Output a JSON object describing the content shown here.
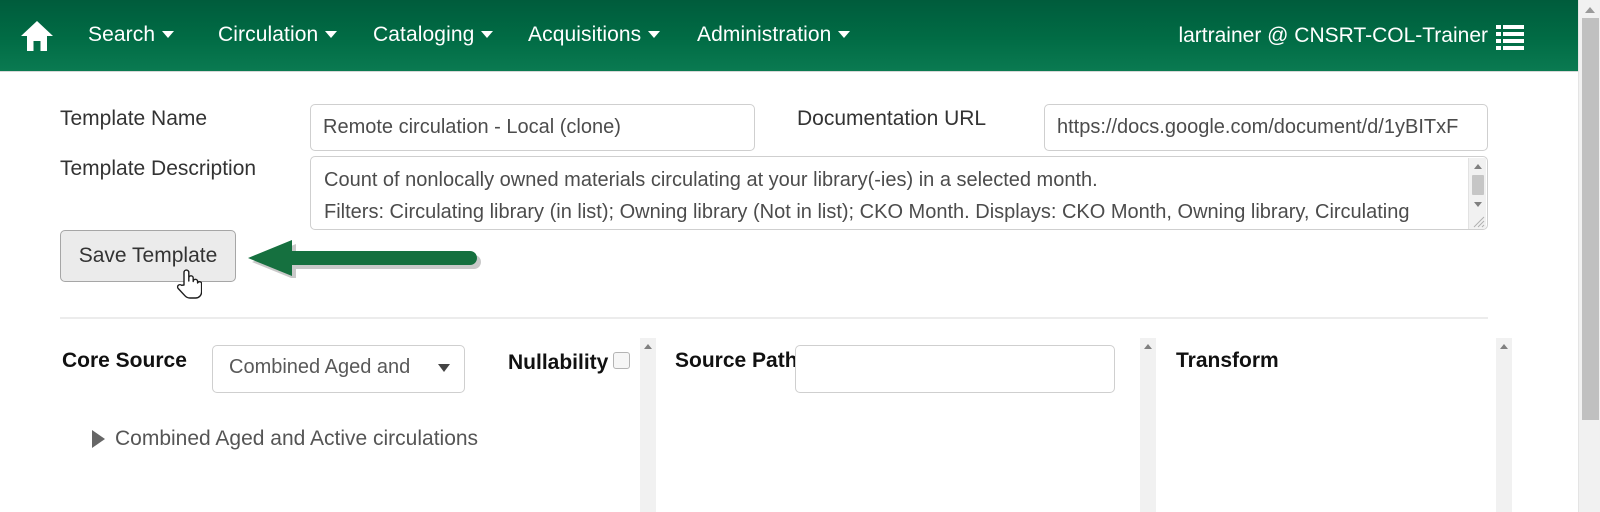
{
  "navbar": {
    "home_icon": "home-icon",
    "menu_icon": "list-icon",
    "items": [
      {
        "label": "Search",
        "caret": true
      },
      {
        "label": "Circulation",
        "caret": true
      },
      {
        "label": "Cataloging",
        "caret": true
      },
      {
        "label": "Acquisitions",
        "caret": true
      },
      {
        "label": "Administration",
        "caret": true
      }
    ],
    "user": "lartrainer @ CNSRT-COL-Trainer",
    "background_color": "#016c45"
  },
  "form": {
    "template_name_label": "Template Name",
    "template_name_value": "Remote circulation - Local (clone)",
    "template_name_placeholder": "",
    "documentation_url_label": "Documentation URL",
    "documentation_url_value": "https://docs.google.com/document/d/1yBITxF",
    "documentation_url_placeholder": "",
    "template_description_label": "Template Description",
    "template_description_value": "Count of nonlocally owned materials circulating at your library(-ies) in a selected month.\nFilters: Circulating library (in list); Owning library (Not in list); CKO Month. Displays: CKO Month, Owning library, Circulating library, Check Hold and Count of Circ. Transcends: Library, Check Hold.",
    "save_button_label": "Save Template"
  },
  "annotation": {
    "arrow_color": "#15703f",
    "arrow_direction": "left",
    "cursor": "pointer-hand-cursor"
  },
  "builder": {
    "core_source_label": "Core Source",
    "core_source_selected": "Combined Aged and Active circulations",
    "core_source_display": "Combined Aged and",
    "tree_items": [
      {
        "label": "Combined Aged and Active circulations",
        "expanded": false
      }
    ],
    "nullability_label": "Nullability",
    "nullability_checked": false,
    "source_path_label": "Source Path",
    "source_path_value": "",
    "source_path_placeholder": "",
    "transform_label": "Transform"
  }
}
